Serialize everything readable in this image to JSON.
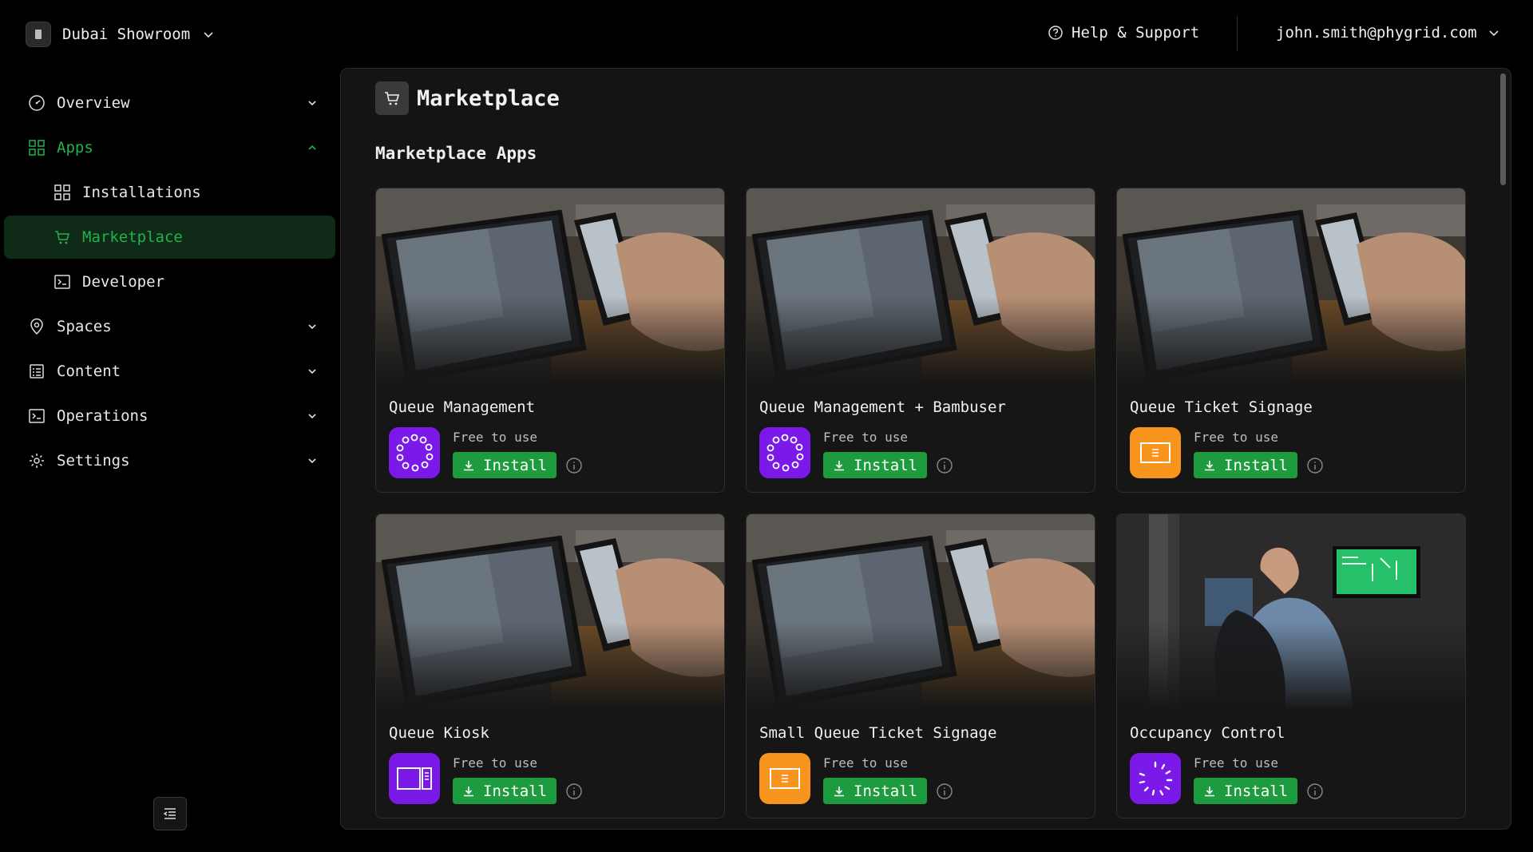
{
  "header": {
    "org_name": "Dubai Showroom",
    "help_label": "Help & Support",
    "user_email": "john.smith@phygrid.com"
  },
  "sidebar": {
    "items": [
      {
        "label": "Overview"
      },
      {
        "label": "Apps"
      },
      {
        "label": "Installations"
      },
      {
        "label": "Marketplace"
      },
      {
        "label": "Developer"
      },
      {
        "label": "Spaces"
      },
      {
        "label": "Content"
      },
      {
        "label": "Operations"
      },
      {
        "label": "Settings"
      }
    ]
  },
  "main": {
    "page_title": "Marketplace",
    "section_title": "Marketplace Apps",
    "apps": [
      {
        "name": "Queue Management",
        "price": "Free to use",
        "install_label": "Install",
        "icon": "ring-dots-icon",
        "icon_color": "#7b19e8"
      },
      {
        "name": "Queue Management + Bambuser",
        "price": "Free to use",
        "install_label": "Install",
        "icon": "ring-dots-icon",
        "icon_color": "#7b19e8"
      },
      {
        "name": "Queue Ticket Signage",
        "price": "Free to use",
        "install_label": "Install",
        "icon": "screen-ticket-icon",
        "icon_color": "#f7941d"
      },
      {
        "name": "Queue Kiosk",
        "price": "Free to use",
        "install_label": "Install",
        "icon": "kiosk-icon",
        "icon_color": "#7b19e8"
      },
      {
        "name": "Small Queue Ticket Signage",
        "price": "Free to use",
        "install_label": "Install",
        "icon": "screen-ticket-icon",
        "icon_color": "#f7941d"
      },
      {
        "name": "Occupancy Control",
        "price": "Free to use",
        "install_label": "Install",
        "icon": "ring-dashes-icon",
        "icon_color": "#7b19e8"
      }
    ]
  },
  "colors": {
    "accent_green": "#22b14c",
    "install_green": "#1e9b3e",
    "purple": "#7b19e8",
    "orange": "#f7941d"
  }
}
